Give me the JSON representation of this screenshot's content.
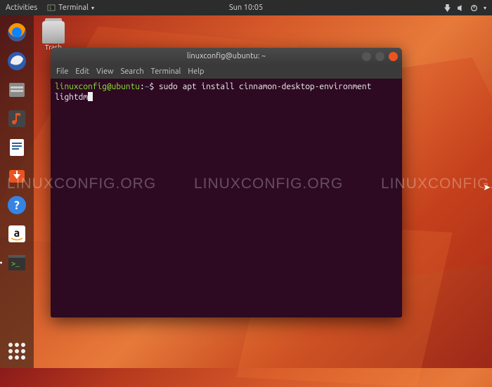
{
  "topbar": {
    "activities": "Activities",
    "app_name": "Terminal",
    "clock": "Sun 10:05"
  },
  "desktop": {
    "trash_label": "Trash"
  },
  "terminal": {
    "title": "linuxconfig@ubuntu: ~",
    "menu": {
      "file": "File",
      "edit": "Edit",
      "view": "View",
      "search": "Search",
      "terminal": "Terminal",
      "help": "Help"
    },
    "prompt_user": "linuxconfig@ubuntu",
    "prompt_sep1": ":",
    "prompt_path": "~",
    "prompt_sep2": "$ ",
    "command": "sudo apt install cinnamon-desktop-environment lightdm"
  },
  "watermark": "LINUXCONFIG.ORG"
}
